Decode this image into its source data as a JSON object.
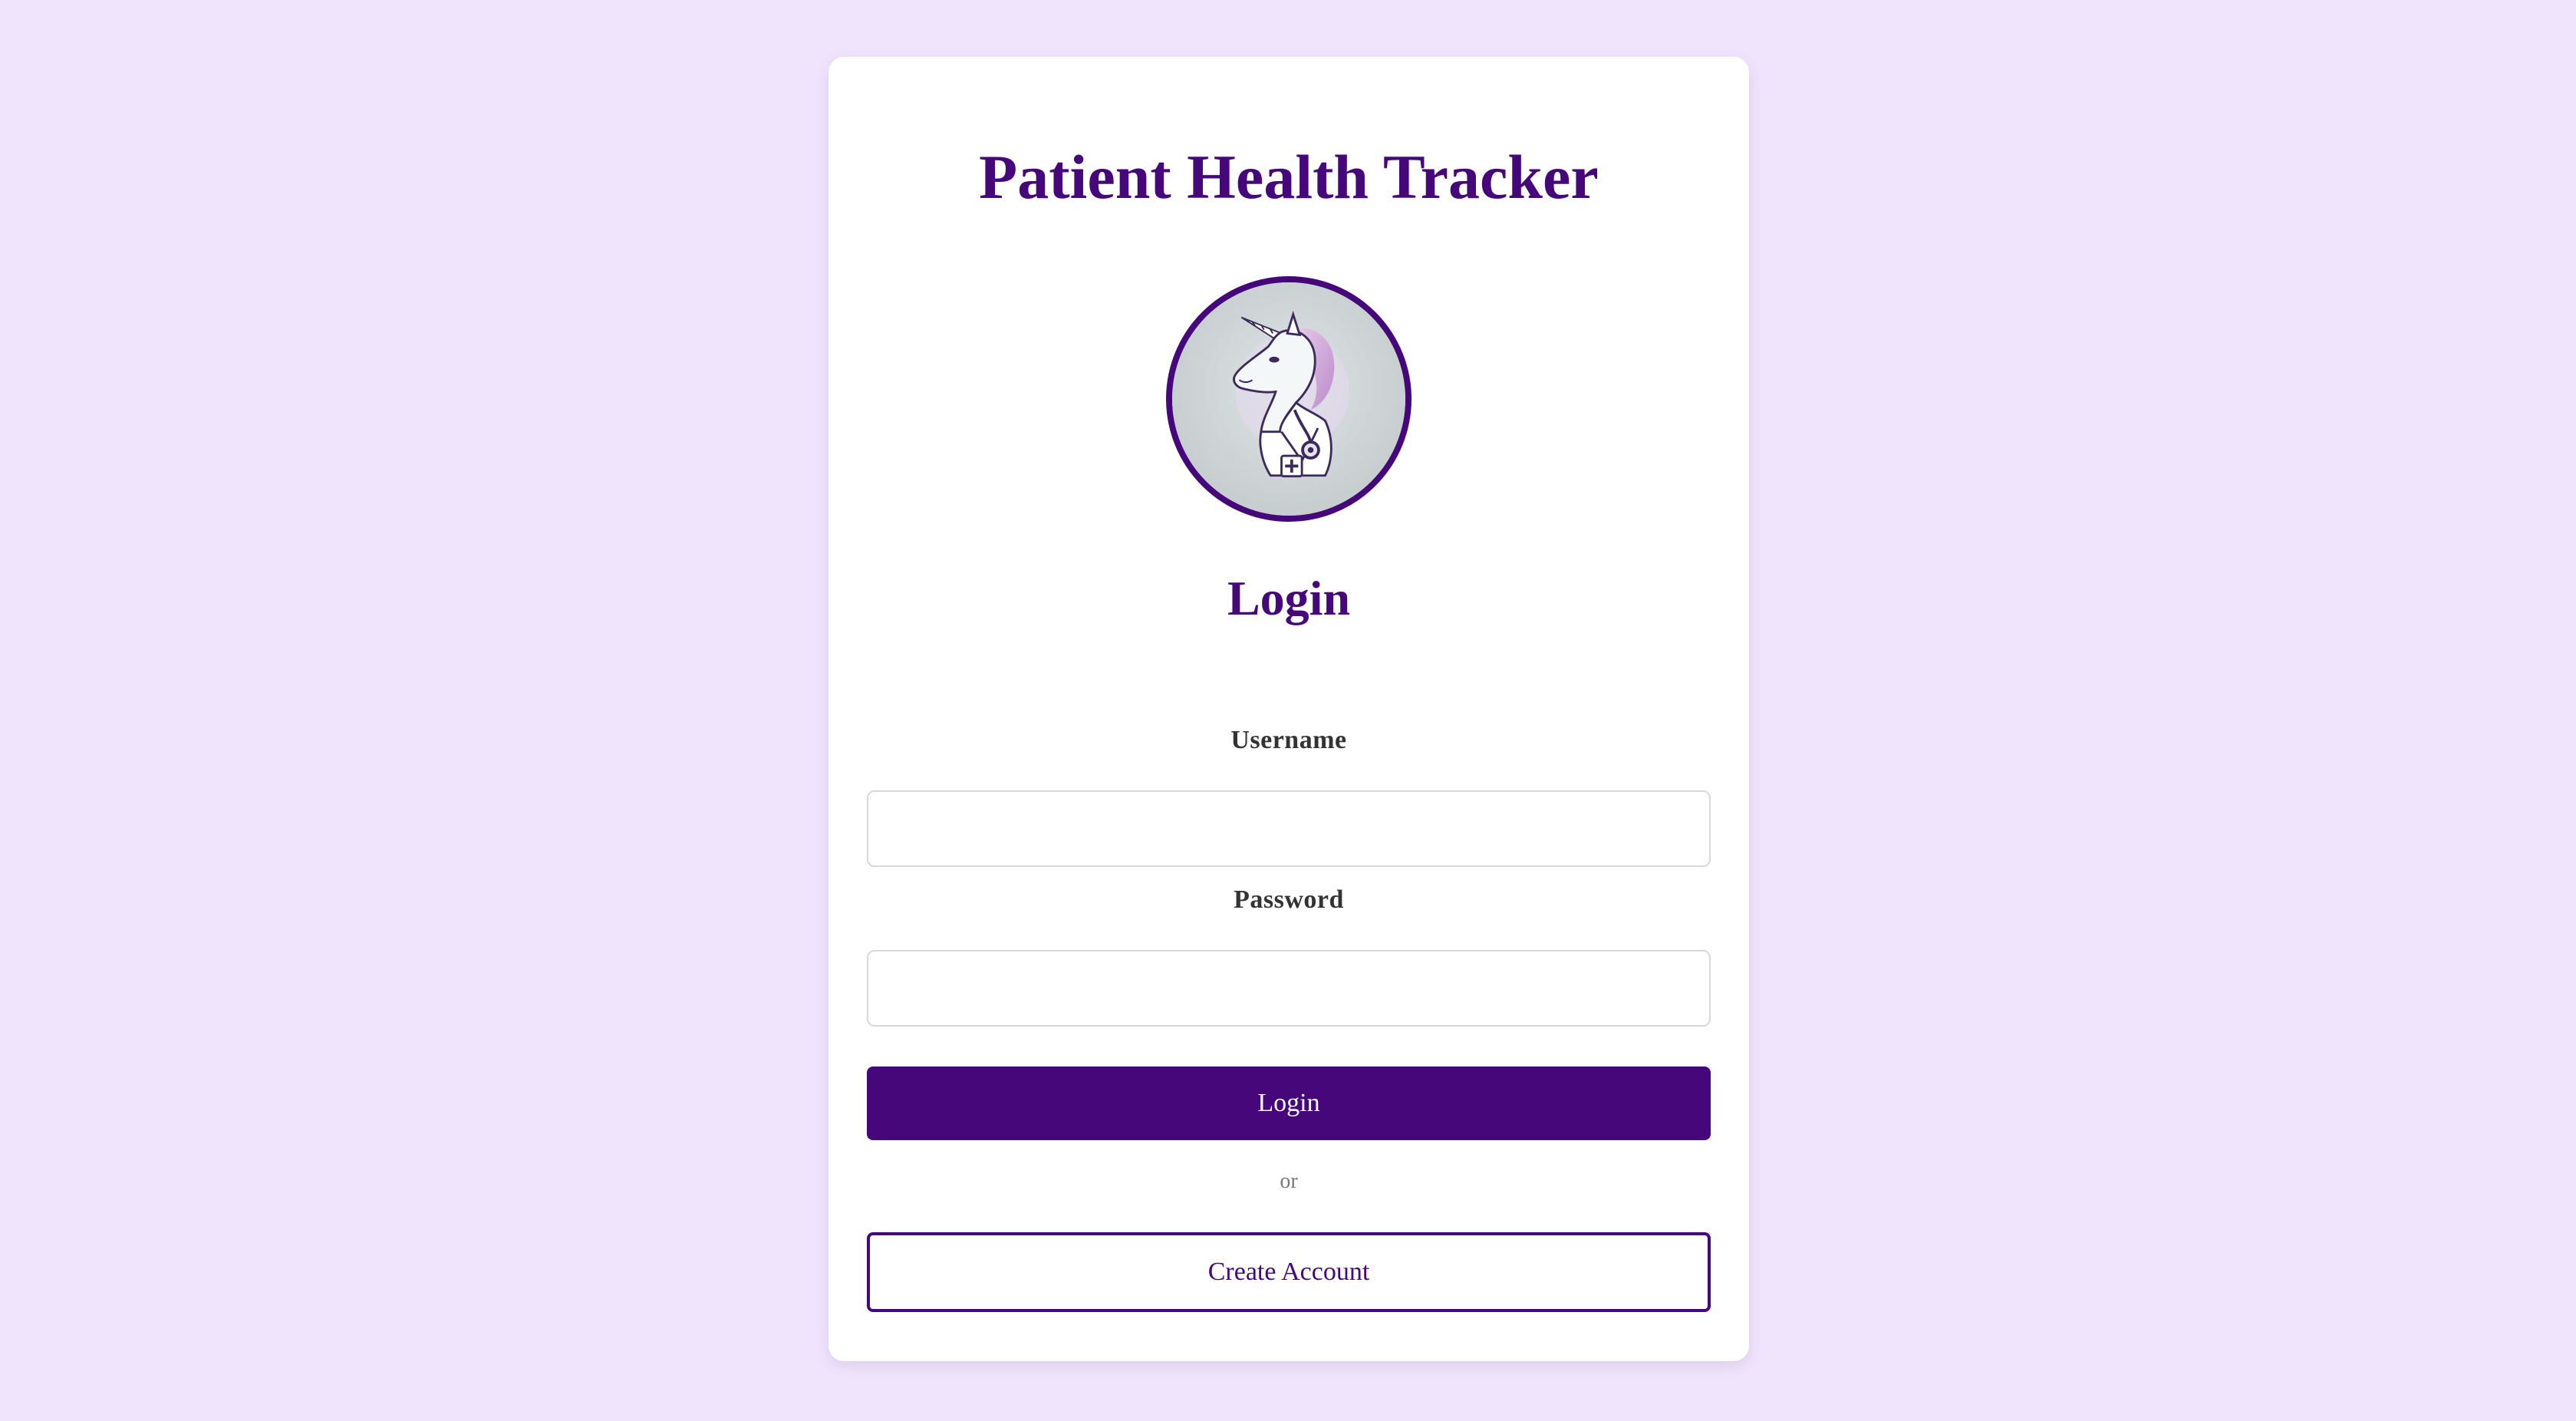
{
  "app": {
    "title": "Patient Health Tracker"
  },
  "logo": {
    "icon": "unicorn-doctor-logo-icon",
    "border_color": "#46077a"
  },
  "login": {
    "heading": "Login",
    "username_label": "Username",
    "username_value": "",
    "username_placeholder": "",
    "password_label": "Password",
    "password_value": "",
    "password_placeholder": "",
    "submit_label": "Login",
    "divider_text": "or",
    "create_account_label": "Create Account"
  },
  "colors": {
    "background": "#f0e4fc",
    "brand": "#46077a",
    "card": "#ffffff"
  }
}
